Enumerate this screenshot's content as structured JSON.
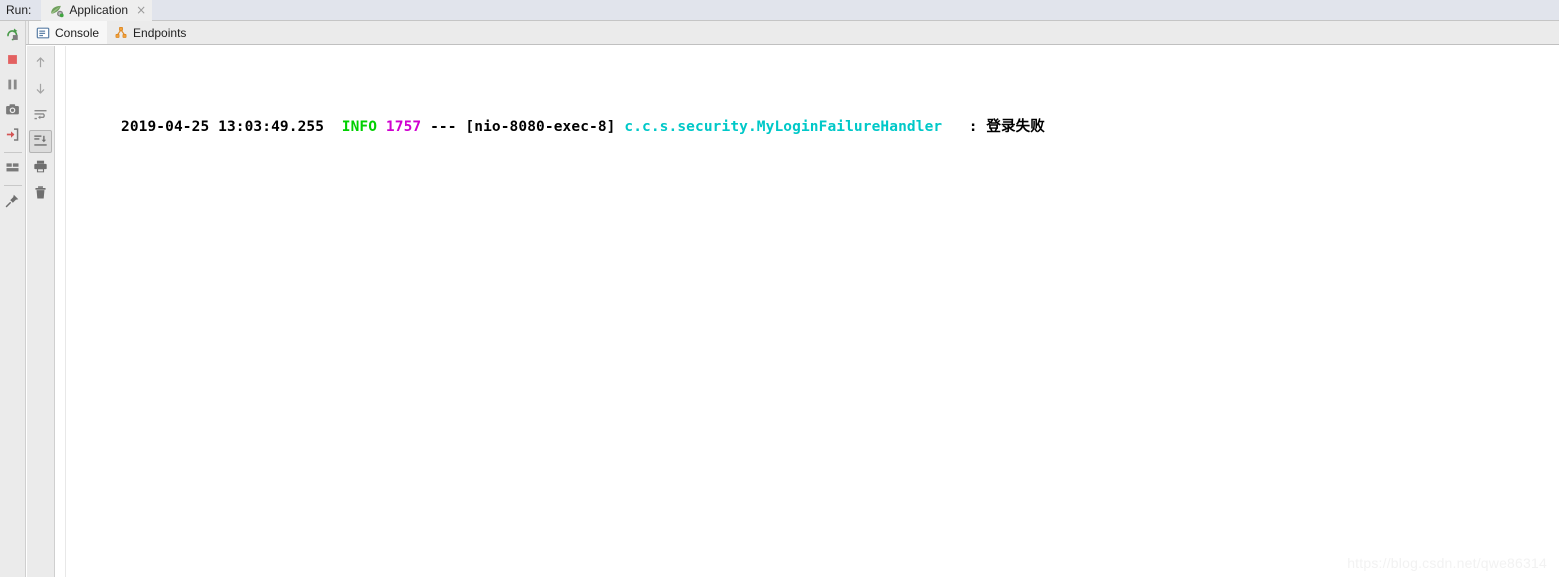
{
  "run_bar": {
    "label": "Run:",
    "tab": {
      "icon": "spring-boot-leaf-icon",
      "title": "Application",
      "close": "×"
    }
  },
  "view_tabs": [
    {
      "icon": "console-icon",
      "label": "Console",
      "active": true
    },
    {
      "icon": "endpoints-icon",
      "label": "Endpoints",
      "active": false
    }
  ],
  "toolbar_primary": [
    {
      "name": "rerun-button",
      "tooltip": "Rerun"
    },
    {
      "name": "stop-button",
      "tooltip": "Stop"
    },
    {
      "name": "pause-button",
      "tooltip": "Pause Output"
    },
    {
      "name": "thread-dump-button",
      "tooltip": "Get Thread Dump"
    },
    {
      "name": "restore-layout-button",
      "tooltip": "Restore Layout"
    },
    {
      "name": "settings-layout-button",
      "tooltip": "Layout Settings"
    },
    {
      "name": "pin-tab-button",
      "tooltip": "Pin Tab"
    }
  ],
  "toolbar_secondary": [
    {
      "name": "up-the-stack-trace-button",
      "tooltip": "Up the Stack Trace"
    },
    {
      "name": "down-the-stack-trace-button",
      "tooltip": "Down the Stack Trace"
    },
    {
      "name": "soft-wrap-button",
      "tooltip": "Use Soft Wraps"
    },
    {
      "name": "scroll-to-end-button",
      "tooltip": "Scroll to the end",
      "selected": true
    },
    {
      "name": "print-button",
      "tooltip": "Print"
    },
    {
      "name": "clear-all-button",
      "tooltip": "Clear All"
    }
  ],
  "console": {
    "lines": [
      {
        "timestamp": "2019-04-25 13:03:49.255",
        "gap1": "  ",
        "level": "INFO",
        "gap2": " ",
        "pid": "1757",
        "separator": " --- ",
        "thread": "[nio-8080-exec-8]",
        "gap3": " ",
        "logger": "c.c.s.security.MyLoginFailureHandler",
        "padding": "   ",
        "colon": ": ",
        "message": "登录失败"
      }
    ]
  },
  "watermark": "https://blog.csdn.net/qwe86314",
  "colors": {
    "run_bar_bg": "#e1e4ec",
    "tab_strip_bg": "#ebebeb",
    "console_bg": "#ffffff",
    "level_info": "#00d000",
    "pid": "#d000d0",
    "logger": "#00c8c8",
    "text": "#000000",
    "stop_red": "#e35b5b",
    "rerun_green": "#53a254",
    "endpoints_orange": "#f0932b"
  }
}
